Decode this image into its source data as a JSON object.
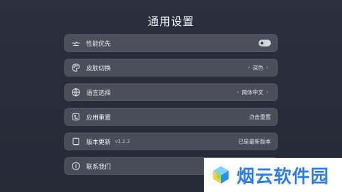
{
  "page": {
    "title": "通用设置"
  },
  "settings": {
    "items": [
      {
        "label": "性能优先",
        "type": "toggle",
        "icon": "rocket-icon"
      },
      {
        "label": "皮肤切换",
        "type": "select",
        "value": "深色",
        "icon": "palette-icon"
      },
      {
        "label": "语言选择",
        "type": "select",
        "value": "简体中文",
        "icon": "globe-icon"
      },
      {
        "label": "应用重置",
        "type": "action",
        "value": "点击重置",
        "icon": "reset-icon"
      },
      {
        "label": "版本更新",
        "type": "status",
        "sub": "v1.2.3",
        "value": "已是最新版本",
        "icon": "version-icon"
      },
      {
        "label": "联系我们",
        "type": "info",
        "icon": "info-icon"
      }
    ]
  },
  "watermark": {
    "text": "烟云软件园"
  },
  "colors": {
    "background": "#2c2f3d",
    "row": "#4a4d5a",
    "text": "#e9ebf0",
    "watermark": "#2f7de1"
  }
}
